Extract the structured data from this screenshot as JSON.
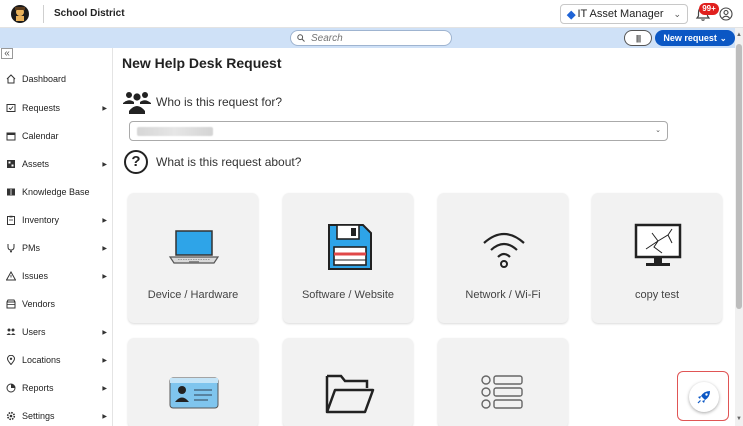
{
  "header": {
    "district_name": "School District",
    "app_name": "IT Asset Manager",
    "notification_count": "99+"
  },
  "search": {
    "placeholder": "Search"
  },
  "toolbar": {
    "new_request_label": "New request"
  },
  "sidebar": {
    "items": [
      {
        "label": "Dashboard",
        "has_submenu": false
      },
      {
        "label": "Requests",
        "has_submenu": true
      },
      {
        "label": "Calendar",
        "has_submenu": false
      },
      {
        "label": "Assets",
        "has_submenu": true
      },
      {
        "label": "Knowledge Base",
        "has_submenu": false
      },
      {
        "label": "Inventory",
        "has_submenu": true
      },
      {
        "label": "PMs",
        "has_submenu": true
      },
      {
        "label": "Issues",
        "has_submenu": true
      },
      {
        "label": "Vendors",
        "has_submenu": false
      },
      {
        "label": "Users",
        "has_submenu": true
      },
      {
        "label": "Locations",
        "has_submenu": true
      },
      {
        "label": "Reports",
        "has_submenu": true
      },
      {
        "label": "Settings",
        "has_submenu": true
      }
    ]
  },
  "main": {
    "title": "New Help Desk Request",
    "question_who": "Who is this request for?",
    "question_what": "What is this request about?",
    "categories": [
      {
        "label": "Device / Hardware",
        "icon": "laptop-icon"
      },
      {
        "label": "Software / Website",
        "icon": "floppy-disk-icon"
      },
      {
        "label": "Network / Wi-Fi",
        "icon": "wifi-icon"
      },
      {
        "label": "copy test",
        "icon": "broken-monitor-icon"
      },
      {
        "label": "",
        "icon": "id-card-icon"
      },
      {
        "label": "",
        "icon": "folder-icon"
      },
      {
        "label": "",
        "icon": "list-icon"
      }
    ]
  },
  "colors": {
    "accent": "#0b57c4",
    "search_band": "#cfe1f7",
    "badge": "#e0201e"
  }
}
